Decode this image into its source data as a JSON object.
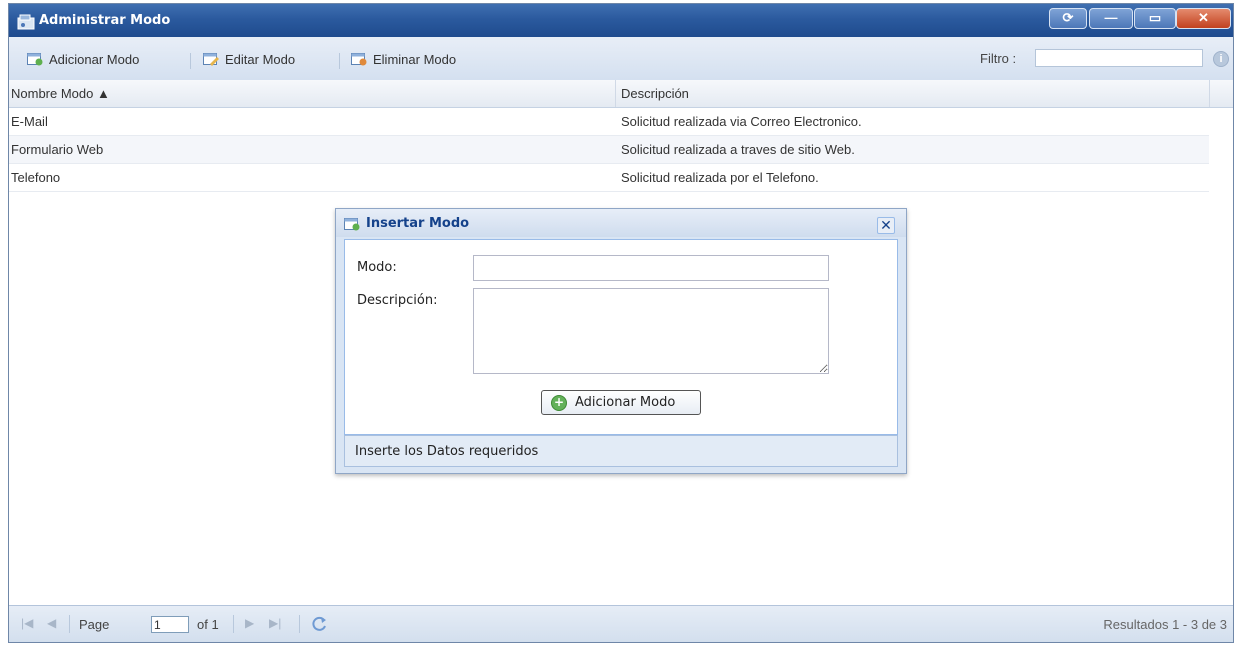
{
  "window": {
    "title": "Administrar Modo",
    "buttons": {
      "restore": "⟳",
      "minimize": "—",
      "maximize": "▭",
      "close": "✕"
    }
  },
  "toolbar": {
    "add_label": "Adicionar Modo",
    "edit_label": "Editar Modo",
    "delete_label": "Eliminar Modo",
    "filter_label": "Filtro :",
    "filter_value": "",
    "info_icon_glyph": "i"
  },
  "grid": {
    "columns": [
      "Nombre Modo ▲",
      "Descripción"
    ],
    "rows": [
      [
        "E-Mail",
        "Solicitud realizada via Correo Electronico."
      ],
      [
        "Formulario Web",
        "Solicitud realizada a traves de sitio Web."
      ],
      [
        "Telefono",
        "Solicitud realizada por el Telefono."
      ]
    ]
  },
  "dialog": {
    "title": "Insertar Modo",
    "close_glyph": "✕",
    "modo_label": "Modo:",
    "modo_value": "",
    "descripcion_label": "Descripción:",
    "descripcion_value": "",
    "button_label": "Adicionar Modo",
    "status": "Inserte los Datos requeridos"
  },
  "pager": {
    "page_label": "Page",
    "page_value": "1",
    "of_label": "of 1",
    "results": "Resultados 1 - 3 de 3"
  },
  "colors": {
    "titlebar": "#2b5a9e",
    "toolbar": "#dfe8f6",
    "dialog_title": "#15428b"
  }
}
